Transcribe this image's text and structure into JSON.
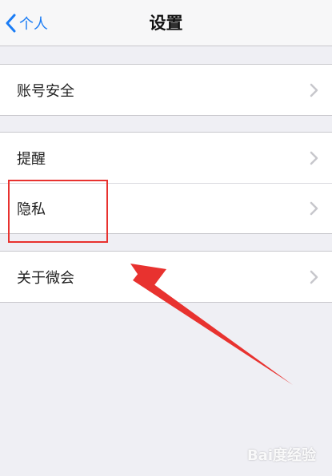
{
  "navbar": {
    "back_label": "个人",
    "title": "设置"
  },
  "groups": [
    {
      "items": [
        {
          "label": "账号安全"
        }
      ]
    },
    {
      "items": [
        {
          "label": "提醒"
        },
        {
          "label": "隐私"
        }
      ]
    },
    {
      "items": [
        {
          "label": "关于微会"
        }
      ]
    }
  ],
  "watermark": {
    "text": "Bai度经验"
  },
  "colors": {
    "accent": "#1a7cf5",
    "annotation": "#e8322f",
    "background": "#efeff4"
  }
}
